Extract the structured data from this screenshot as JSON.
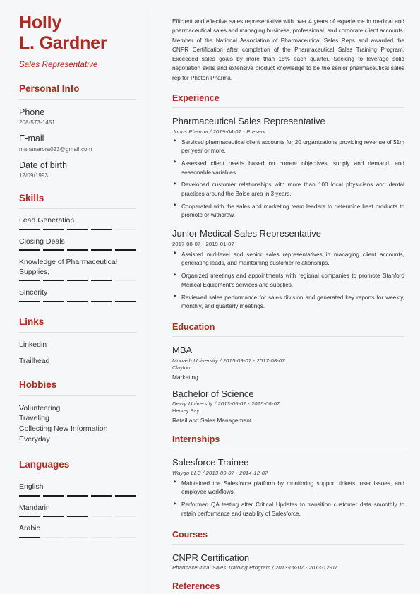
{
  "theme": {
    "accent": "#b0281f",
    "text": "#2e2e2e",
    "rule": "#dddfe2"
  },
  "header": {
    "first_name": "Holly",
    "last_name": "L. Gardner",
    "job_title": "Sales Representative"
  },
  "sidebar": {
    "personal_info": {
      "heading": "Personal Info",
      "fields": [
        {
          "label": "Phone",
          "value": "208-573-1451"
        },
        {
          "label": "E-mail",
          "value": "mananarora023@gmail.com"
        },
        {
          "label": "Date of birth",
          "value": "12/09/1993"
        }
      ]
    },
    "skills": {
      "heading": "Skills",
      "max": 5,
      "items": [
        {
          "name": "Lead Generation",
          "level": 4
        },
        {
          "name": "Closing Deals",
          "level": 5
        },
        {
          "name": "Knowledge of Pharmaceutical Supplies,",
          "level": 4
        },
        {
          "name": "Sincerity",
          "level": 5
        }
      ]
    },
    "links": {
      "heading": "Links",
      "items": [
        "Linkedin",
        "Trailhead"
      ]
    },
    "hobbies": {
      "heading": "Hobbies",
      "items": [
        "Volunteering",
        "Traveling",
        "Collecting New Information",
        "Everyday"
      ]
    },
    "languages": {
      "heading": "Languages",
      "max": 5,
      "items": [
        {
          "name": "English",
          "level": 5
        },
        {
          "name": "Mandarin",
          "level": 3
        },
        {
          "name": "Arabic",
          "level": 1
        }
      ]
    }
  },
  "main": {
    "summary": "Efficient and effective sales representative with over 4 years of experience in medical and pharmaceutical sales and managing business, professional, and corporate client accounts. Member of the National Association of Pharmaceutical Sales Reps and awarded the CNPR Certification after completion of the Pharmaceutical Sales Training Program. Exceeded sales goals by more than 15% each quarter. Seeking to leverage solid negotiation skills and extensive product knowledge to be the senior pharmaceutical sales rep for Photon Pharma.",
    "experience": {
      "heading": "Experience",
      "entries": [
        {
          "title": "Pharmaceutical Sales Representative",
          "meta": "Jurius Pharma /  2019-04-07 - Present",
          "bullets": [
            "Serviced pharmaceutical client accounts for 20 organizations providing revenue of $1m per year or more.",
            "Assessed client needs based on current objectives, supply and demand, and seasonable variables.",
            "Developed customer relationships with more than 100 local physicians and dental practices around the Boise area in 3 years.",
            "Cooperated with the sales and marketing team leaders to determine best products to promote or withdraw."
          ]
        },
        {
          "title": "Junior Medical Sales Representative",
          "meta": "2017-08-07 - 2019-01-07",
          "bullets": [
            "Assisted mid-level and senior sales representatives in managing client accounts, generating leads, and maintaining customer relationships.",
            "Organized meetings and appointments with regional companies to promote Stanford Medical Equipment's services and supplies.",
            "Reviewed sales performance for sales division and generated key reports for weekly, monthly, and quarterly meetings."
          ]
        }
      ]
    },
    "education": {
      "heading": "Education",
      "entries": [
        {
          "title": "MBA",
          "meta": "Monash University /  2015-09-07 - 2017-08-07",
          "location": "Clayton",
          "field": "Marketing"
        },
        {
          "title": "Bachelor of Science",
          "meta": "Devry University /  2013-05-07 - 2015-08-07",
          "location": "Hervey Bay",
          "field": "Retail and Sales Management"
        }
      ]
    },
    "internships": {
      "heading": "Internships",
      "entries": [
        {
          "title": "Salesforce Trainee",
          "meta": "Waygo LLC /  2013-09-07 - 2014-12-07",
          "bullets": [
            "Maintained the Salesforce platform by monitoring support tickets, user issues, and employee workflows.",
            "Performed QA testing after Critical Updates to transition customer data smoothly to retain performance and usability of Salesforce."
          ]
        }
      ]
    },
    "courses": {
      "heading": "Courses",
      "entries": [
        {
          "title": "CNPR Certification",
          "meta": "Pharmaceutical Sales Training Program /  2013-08-07 - 2013-12-07"
        }
      ]
    },
    "references": {
      "heading": "References"
    }
  }
}
